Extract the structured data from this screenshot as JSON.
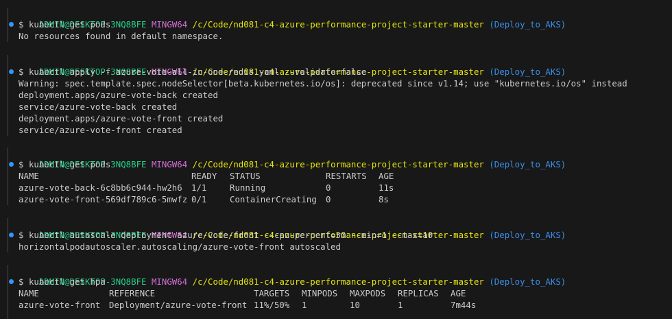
{
  "prompt": {
    "user": "ADMIN@DESKTOP-3NQ8BFE",
    "shell": "MINGW64",
    "path": "/c/Code/nd081-c4-azure-performance-project-starter-master",
    "branch": "(Deploy_to_AKS)",
    "symbol": "$",
    "colors": {
      "user": "#23d18b",
      "shell": "#d670d6",
      "path": "#e5e510",
      "branch": "#3b8eea"
    }
  },
  "blocks": [
    {
      "command": "kubectl get pods",
      "output": [
        "No resources found in default namespace."
      ]
    },
    {
      "command": "kubectl apply -f azure-vote-all-in-one-redis.yaml --validate=false",
      "output": [
        "Warning: spec.template.spec.nodeSelector[beta.kubernetes.io/os]: deprecated since v1.14; use \"kubernetes.io/os\" instead",
        "deployment.apps/azure-vote-back created",
        "service/azure-vote-back created",
        "deployment.apps/azure-vote-front created",
        "service/azure-vote-front created"
      ]
    },
    {
      "command": "kubectl get pods",
      "table": {
        "headers": [
          "NAME",
          "READY",
          "STATUS",
          "RESTARTS",
          "AGE"
        ],
        "rows": [
          [
            "azure-vote-back-6c8bb6c944-hw2h6",
            "1/1",
            "Running",
            "0",
            "11s"
          ],
          [
            "azure-vote-front-569df789c6-5mwfz",
            "0/1",
            "ContainerCreating",
            "0",
            "8s"
          ]
        ]
      }
    },
    {
      "command": "kubectl autoscale deployment azure-vote-front --cpu-percent=50 --min=1 --max=10",
      "output": [
        "horizontalpodautoscaler.autoscaling/azure-vote-front autoscaled"
      ]
    },
    {
      "command": "kubectl get hpa",
      "table": {
        "headers": [
          "NAME",
          "REFERENCE",
          "TARGETS",
          "MINPODS",
          "MAXPODS",
          "REPLICAS",
          "AGE"
        ],
        "rows": [
          [
            "azure-vote-front",
            "Deployment/azure-vote-front",
            "11%/50%",
            "1",
            "10",
            "1",
            "7m44s"
          ]
        ]
      }
    }
  ]
}
